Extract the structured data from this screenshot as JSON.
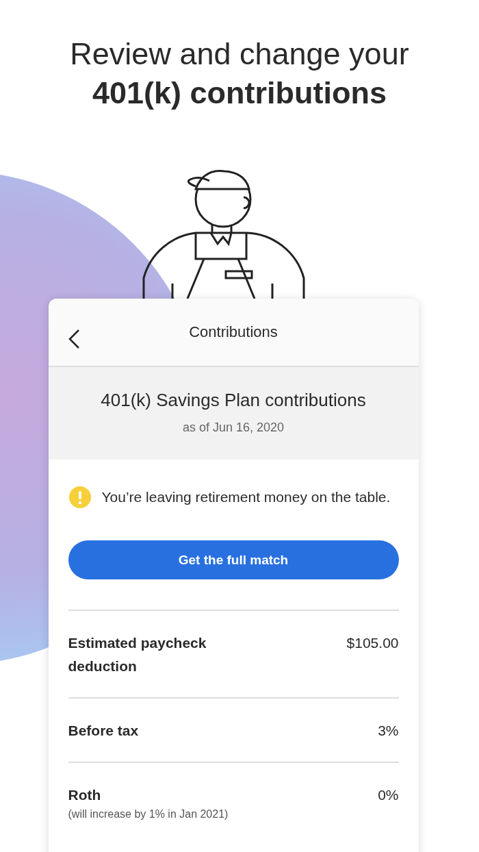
{
  "headline": {
    "line_1": "Review and change your",
    "line_2": "401(k) contributions"
  },
  "screen": {
    "title": "Contributions",
    "plan": {
      "name": "401(k) Savings Plan contributions",
      "as_of": "as of Jun 16, 2020"
    },
    "alert": {
      "kind": "warning",
      "message": "You’re leaving retirement money on the table."
    },
    "button": "Get the full match",
    "rows": [
      {
        "label": "Estimated paycheck deduction",
        "value": "$105.00"
      },
      {
        "label": "Before tax",
        "value": "3%"
      },
      {
        "label": "Roth",
        "value": "0%",
        "note": "(will increase by 1% in Jan 2021)"
      }
    ]
  }
}
